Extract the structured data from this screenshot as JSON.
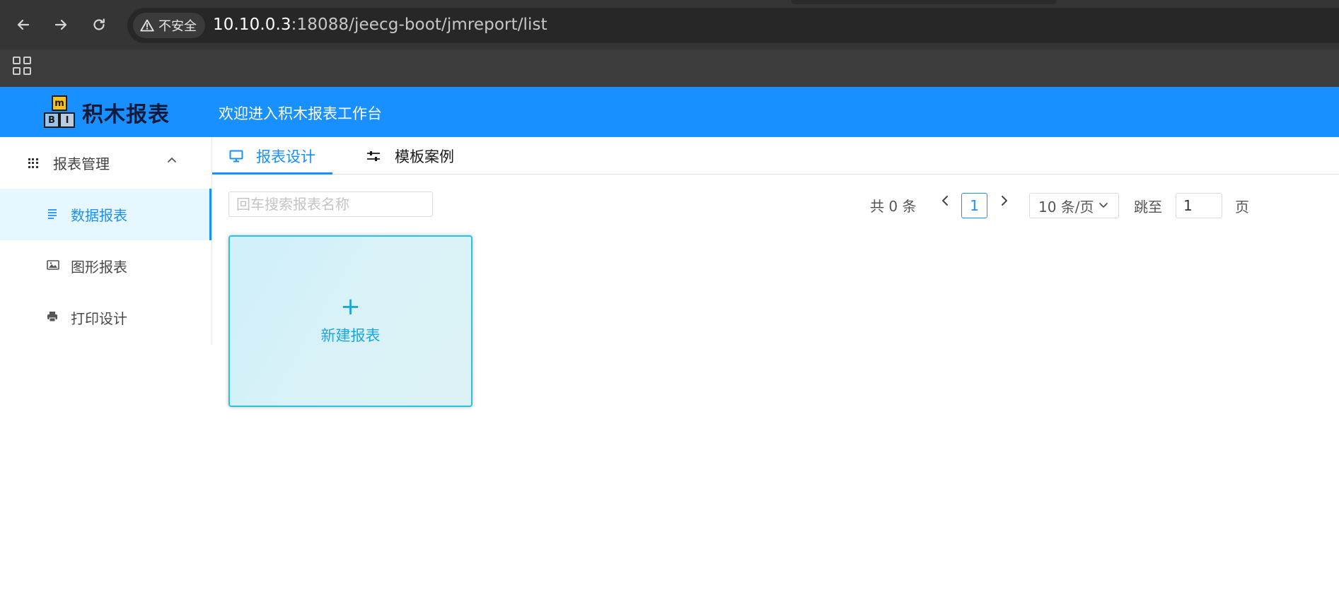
{
  "browser": {
    "security_label": "不安全",
    "url_host": "10.10.0.3",
    "url_rest": ":18088/jeecg-boot/jmreport/list"
  },
  "header": {
    "logo_blocks": [
      "m",
      "B",
      "I"
    ],
    "logo_text": "积木报表",
    "welcome": "欢迎进入积木报表工作台"
  },
  "sidebar": {
    "group_label": "报表管理",
    "items": [
      {
        "label": "数据报表",
        "icon": "list-icon",
        "active": true
      },
      {
        "label": "图形报表",
        "icon": "image-icon",
        "active": false
      },
      {
        "label": "打印设计",
        "icon": "printer-icon",
        "active": false
      }
    ]
  },
  "tabs": [
    {
      "label": "报表设计",
      "icon": "monitor-icon",
      "active": true
    },
    {
      "label": "模板案例",
      "icon": "sliders-icon",
      "active": false
    }
  ],
  "search": {
    "placeholder": "回车搜索报表名称",
    "value": ""
  },
  "pagination": {
    "total": "共 0 条",
    "current_page": "1",
    "page_size": "10 条/页",
    "jump_label": "跳至",
    "jump_value": "1",
    "jump_suffix": "页"
  },
  "new_card": {
    "plus": "+",
    "label": "新建报表"
  },
  "colors": {
    "primary": "#1890ff",
    "card_accent": "#1aa7e0",
    "card_border": "#29c4d9"
  }
}
